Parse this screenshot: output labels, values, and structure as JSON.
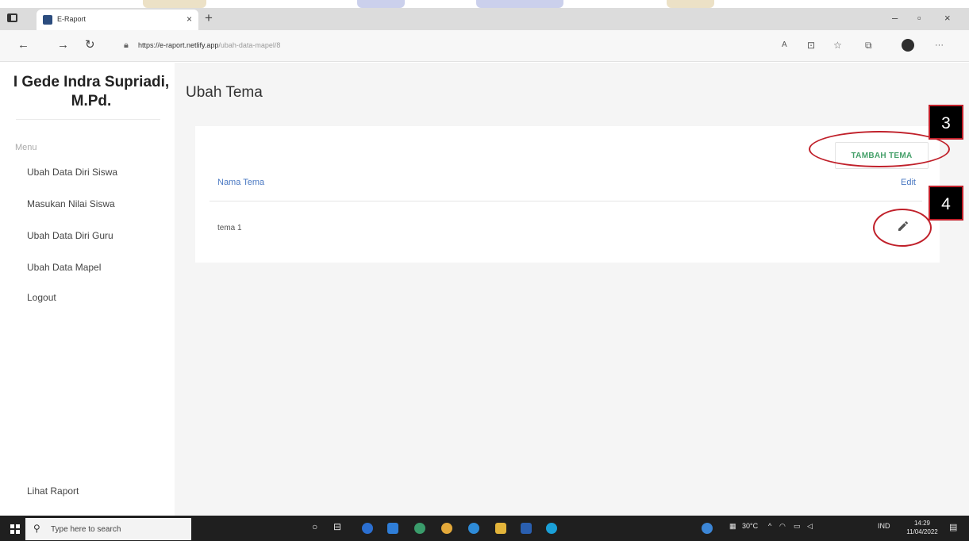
{
  "browser": {
    "tab_title": "E-Raport",
    "tab_close": "×",
    "new_tab": "+",
    "url_host": "https://e-raport.netlify.app",
    "url_path": "/ubah-data-mapel/8",
    "window_controls": {
      "minimize": "–",
      "maximize": "▫",
      "close": "×"
    }
  },
  "sidebar": {
    "user_name": "I Gede Indra Supriadi, M.Pd.",
    "menu_caption": "Menu",
    "items": [
      {
        "label": "Ubah Data Diri Siswa"
      },
      {
        "label": "Masukan Nilai Siswa"
      },
      {
        "label": "Ubah Data Diri Guru"
      },
      {
        "label": "Ubah Data Mapel"
      },
      {
        "label": "Logout"
      }
    ],
    "bottom_link": "Lihat Raport"
  },
  "main": {
    "page_title": "Ubah Tema",
    "add_button": "TAMBAH TEMA",
    "table": {
      "columns": [
        "Nama Tema",
        "Edit"
      ],
      "rows": [
        {
          "nama": "tema 1"
        }
      ]
    }
  },
  "annotations": [
    {
      "number": "3",
      "target": "tambah-tema-button"
    },
    {
      "number": "4",
      "target": "edit-icon"
    }
  ],
  "taskbar": {
    "search_placeholder": "Type here to search",
    "weather": "30°C",
    "language": "IND",
    "time": "14:29",
    "date": "11/04/2022"
  },
  "colors": {
    "accent_green": "#45a06a",
    "header_blue": "#4a78c2",
    "annotation_red": "#c0202a"
  }
}
